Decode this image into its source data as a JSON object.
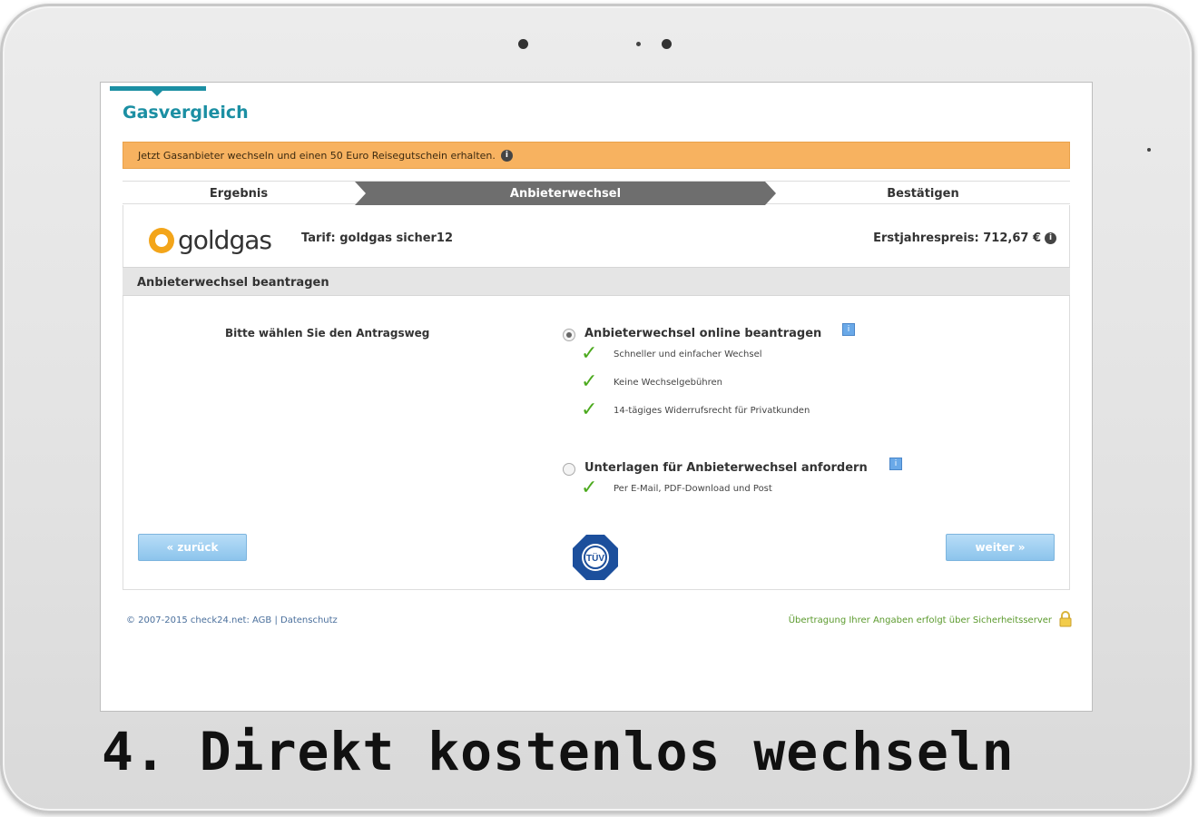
{
  "app": {
    "title": "Gasvergleich"
  },
  "promo": {
    "text": "Jetzt Gasanbieter wechseln und einen 50 Euro Reisegutschein erhalten.",
    "info_glyph": "i"
  },
  "steps": [
    {
      "label": "Ergebnis",
      "active": false
    },
    {
      "label": "Anbieterwechsel",
      "active": true
    },
    {
      "label": "Bestätigen",
      "active": false
    }
  ],
  "provider": {
    "logo_text": "goldgas",
    "tariff": "Tarif: goldgas sicher12",
    "price": "Erstjahrespreis: 712,67 €",
    "price_info_glyph": "i"
  },
  "section": {
    "title": "Anbieterwechsel beantragen"
  },
  "form": {
    "choose_label": "Bitte wählen Sie den Antragsweg",
    "options": [
      {
        "label": "Anbieterwechsel online beantragen",
        "selected": true,
        "bullets": [
          "Schneller und einfacher Wechsel",
          "Keine Wechselgebühren",
          "14-tägiges Widerrufsrecht für Privatkunden"
        ]
      },
      {
        "label": "Unterlagen für Anbieterwechsel anfordern",
        "selected": false,
        "bullets": [
          "Per E-Mail, PDF-Download und Post"
        ]
      }
    ],
    "help_glyph": "i",
    "check_glyph": "✓"
  },
  "buttons": {
    "back": "« zurück",
    "next": "weiter »"
  },
  "badge": {
    "text": "TÜV"
  },
  "footer": {
    "left": "© 2007-2015 check24.net: AGB | Datenschutz",
    "right": "Übertragung Ihrer Angaben erfolgt über Sicherheitsserver"
  },
  "caption": "4. Direkt kostenlos wechseln",
  "colors": {
    "accent": "#1b8fa3",
    "promo": "#f7b260",
    "active_step": "#6e6e6e",
    "check": "#4caa1e",
    "button": "#8cc4ec"
  },
  "icons": [
    "info-icon",
    "help-icon",
    "check-icon",
    "lock-icon",
    "tuv-badge-icon",
    "logo-flame-icon"
  ]
}
